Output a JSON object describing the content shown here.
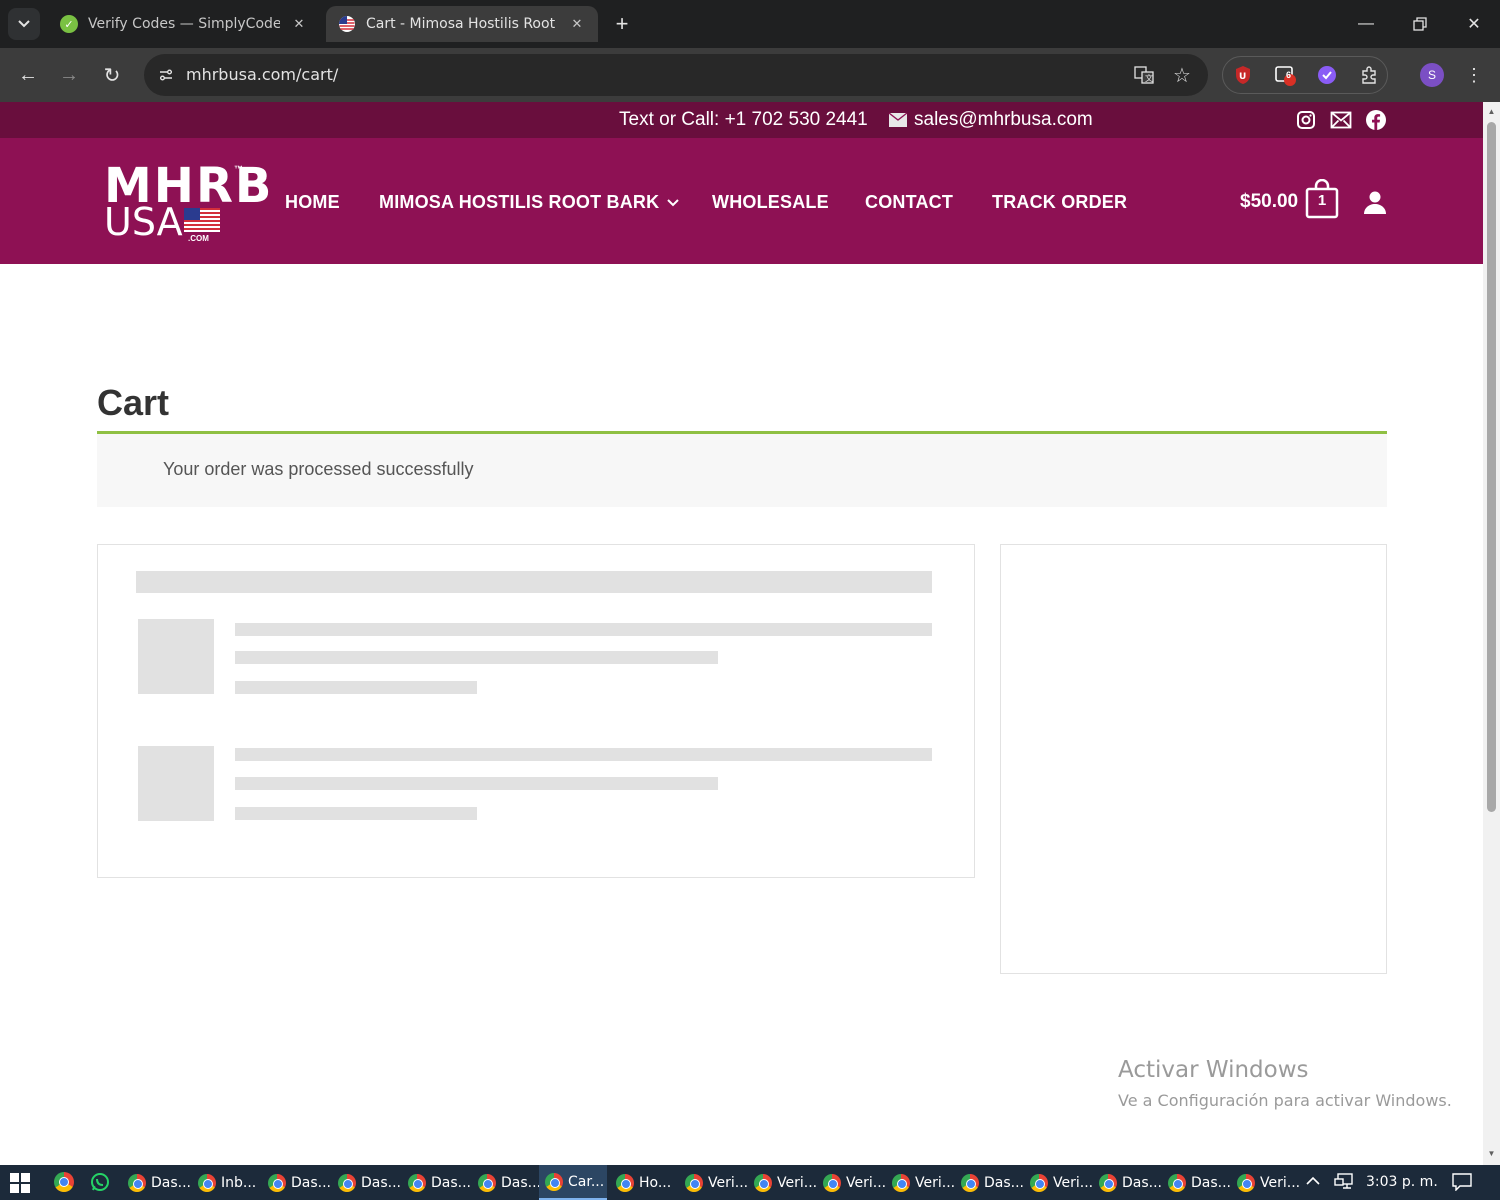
{
  "browser": {
    "tabs": [
      {
        "title": "Verify Codes — SimplyCodes",
        "active": false,
        "favicon": "simplycodes-check-icon"
      },
      {
        "title": "Cart - Mimosa Hostilis Root Bar",
        "active": true,
        "favicon": "us-flag-icon"
      }
    ],
    "url": "mhrbusa.com/cart/",
    "extension_badge": "6",
    "profile_initial": "S"
  },
  "site": {
    "topbar": {
      "phone": "Text or Call: +1 702 530 2441",
      "email": "sales@mhrbusa.com"
    },
    "logo": {
      "line1": "MHRB",
      "tm": "™",
      "line2": "USA",
      "dotcom": ".COM"
    },
    "menu": [
      {
        "label": "HOME"
      },
      {
        "label": "MIMOSA HOSTILIS ROOT BARK",
        "has_dropdown": true
      },
      {
        "label": "WHOLESALE"
      },
      {
        "label": "CONTACT"
      },
      {
        "label": "TRACK ORDER"
      }
    ],
    "cart": {
      "total": "$50.00",
      "count": "1"
    },
    "colors": {
      "topbar": "#690e3d",
      "nav": "#8e1154",
      "notice_border": "#8fc043"
    }
  },
  "content": {
    "page_title": "Cart",
    "notice": "Your order was processed successfully"
  },
  "watermark": {
    "title": "Activar Windows",
    "subtitle": "Ve a Configuración para activar Windows."
  },
  "taskbar": {
    "apps": [
      {
        "label": "Das..."
      },
      {
        "label": "Inb..."
      },
      {
        "label": "Das..."
      },
      {
        "label": "Das..."
      },
      {
        "label": "Das..."
      },
      {
        "label": "Das..."
      },
      {
        "label": "Car...",
        "active": true
      },
      {
        "label": "Ho..."
      },
      {
        "label": "Veri..."
      },
      {
        "label": "Veri..."
      },
      {
        "label": "Veri..."
      },
      {
        "label": "Veri..."
      },
      {
        "label": "Das..."
      },
      {
        "label": "Veri..."
      },
      {
        "label": "Das..."
      },
      {
        "label": "Das..."
      },
      {
        "label": "Veri..."
      }
    ],
    "time": "3:03 p. m."
  }
}
